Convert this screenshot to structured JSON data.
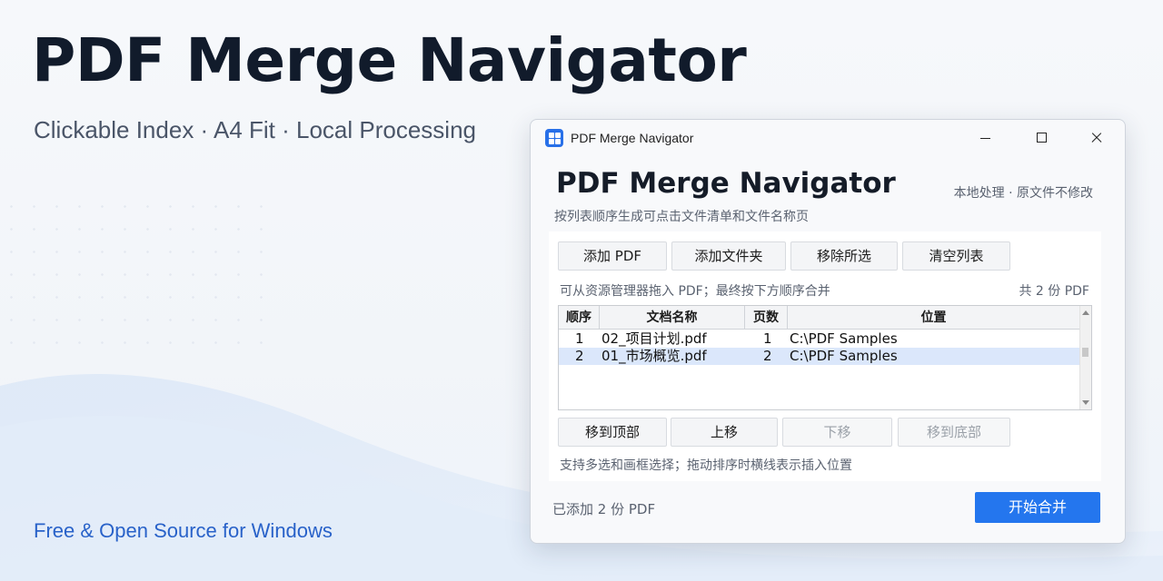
{
  "hero": {
    "title": "PDF Merge Navigator",
    "subtitle": "Clickable Index · A4 Fit · Local Processing",
    "footer": "Free & Open Source for Windows"
  },
  "window": {
    "title": "PDF Merge Navigator",
    "icon": "app-grid-icon",
    "controls": [
      "minimize-icon",
      "maximize-icon",
      "close-icon"
    ]
  },
  "app": {
    "heading": "PDF Merge Navigator",
    "description": "按列表顺序生成可点击文件清单和文件名称页",
    "note": "本地处理 · 原文件不修改"
  },
  "toolbar": {
    "add_pdf": "添加 PDF",
    "add_folder": "添加文件夹",
    "remove_selected": "移除所选",
    "clear_list": "清空列表"
  },
  "list_hint": "可从资源管理器拖入 PDF；最终按下方顺序合并",
  "count_label": "共 2 份 PDF",
  "table": {
    "columns": [
      "顺序",
      "文档名称",
      "页数",
      "位置"
    ],
    "rows": [
      {
        "order": "1",
        "name": "02_项目计划.pdf",
        "pages": "1",
        "location": "C:\\PDF Samples",
        "selected": false
      },
      {
        "order": "2",
        "name": "01_市场概览.pdf",
        "pages": "2",
        "location": "C:\\PDF Samples",
        "selected": true
      }
    ]
  },
  "move": {
    "top": "移到顶部",
    "up": "上移",
    "down": "下移",
    "bottom": "移到底部"
  },
  "move_hint": "支持多选和画框选择；拖动排序时横线表示插入位置",
  "footer": {
    "status": "已添加 2 份 PDF",
    "start": "开始合并"
  },
  "colors": {
    "accent": "#2476ee",
    "selected_row": "#dbe7fb",
    "hero_footer": "#2962c9"
  }
}
